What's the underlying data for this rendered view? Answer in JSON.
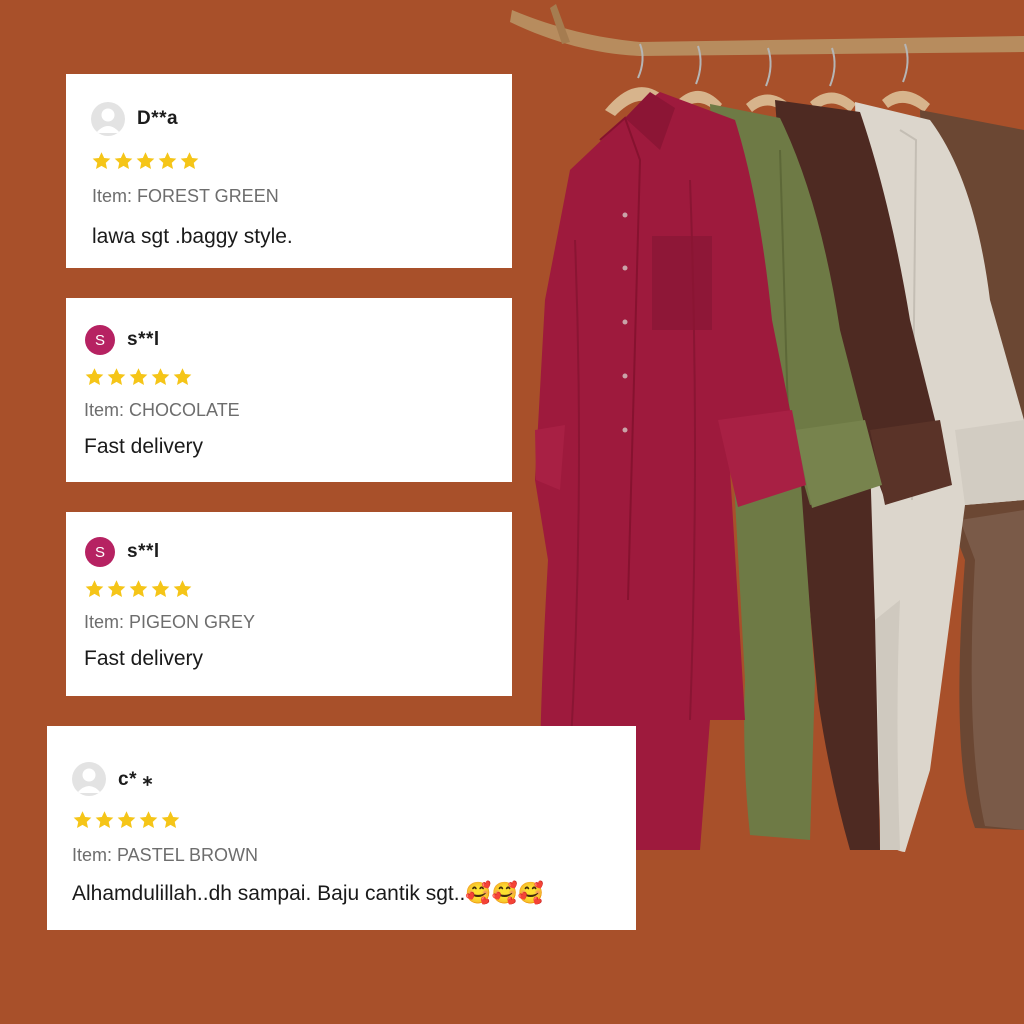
{
  "colors": {
    "background": "#a8502a",
    "card": "#ffffff",
    "star": "#f5c518",
    "avatar_placeholder": "#e3e3e3",
    "avatar_initial_bg": "#b62262",
    "shirt_colors": [
      "#9e1a3d",
      "#6e7a45",
      "#4e2a22",
      "#dcd6cc",
      "#6b4733"
    ]
  },
  "reviews": [
    {
      "reviewer": "D**a",
      "avatar": "user-placeholder-icon",
      "rating": 5,
      "item": "Item: FOREST GREEN",
      "comment": "lawa sgt .baggy style."
    },
    {
      "reviewer": "s**l",
      "avatar_initial": "S",
      "rating": 5,
      "item": "Item: CHOCOLATE",
      "comment": "Fast delivery"
    },
    {
      "reviewer": "s**l",
      "avatar_initial": "S",
      "rating": 5,
      "item": "Item: PIGEON GREY",
      "comment": "Fast delivery"
    },
    {
      "reviewer": "c* ⁎",
      "avatar": "user-placeholder-icon",
      "rating": 5,
      "item": "Item: PASTEL BROWN",
      "comment": "Alhamdulillah..dh sampai.  Baju cantik sgt..🥰🥰🥰"
    }
  ]
}
